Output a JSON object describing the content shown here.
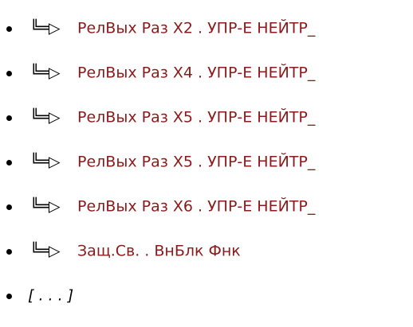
{
  "tree": {
    "branch_glyph": "╚═▷",
    "items": [
      {
        "label": "РелВых Раз Х2 . УПР-Е НЕЙТР_"
      },
      {
        "label": "РелВых Раз Х4 . УПР-Е НЕЙТР_"
      },
      {
        "label": "РелВых Раз Х5 . УПР-Е НЕЙТР_"
      },
      {
        "label": "РелВых Раз Х5 . УПР-Е НЕЙТР_"
      },
      {
        "label": "РелВых Раз Х6 . УПР-Е НЕЙТР_"
      },
      {
        "label": "Защ.Св. . ВнБлк Фнк"
      }
    ],
    "more_label": "[ . . . ]"
  },
  "colors": {
    "link": "#8b1a1a",
    "bullet": "#000000",
    "background": "#ffffff"
  }
}
